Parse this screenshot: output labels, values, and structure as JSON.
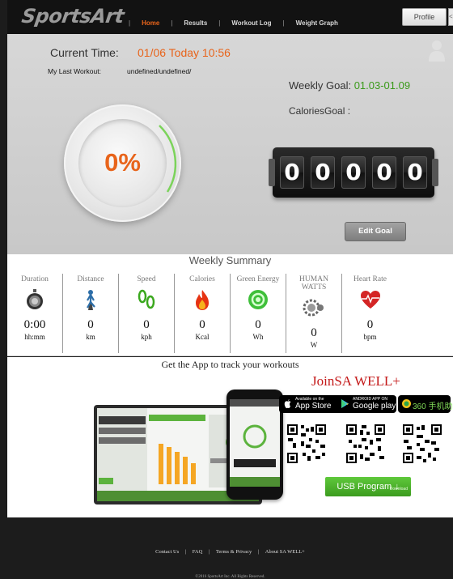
{
  "header": {
    "logo_text": "SportsArt",
    "nav": [
      {
        "label": "Home",
        "active": true
      },
      {
        "label": "Results"
      },
      {
        "label": "Workout Log"
      },
      {
        "label": "Weight Graph"
      }
    ],
    "separator": "|",
    "profile_label": "Profile",
    "profile_more": "<"
  },
  "top": {
    "current_time_label": "Current Time:",
    "current_time_value": "01/06 Today 10:56",
    "last_workout_label": "My Last Workout:",
    "last_workout_value": "undefined/undefined/",
    "weekly_goal_label": "Weekly Goal: ",
    "weekly_goal_value": "01.03-01.09",
    "calories_goal_label": "CaloriesGoal :",
    "progress_percent": "0%",
    "counter_digits": [
      "0",
      "0",
      "0",
      "0",
      "0"
    ],
    "edit_goal_label": "Edit Goal"
  },
  "summary": {
    "title": "Weekly Summary",
    "metrics": [
      {
        "label": "Duration",
        "value": "0:00",
        "unit": "hh:mm",
        "icon": "stopwatch-icon"
      },
      {
        "label": "Distance",
        "value": "0",
        "unit": "km",
        "icon": "road-icon"
      },
      {
        "label": "Speed",
        "value": "0",
        "unit": "kph",
        "icon": "footprints-icon"
      },
      {
        "label": "Calories",
        "value": "0",
        "unit": "Kcal",
        "icon": "flame-icon"
      },
      {
        "label": "Green Energy",
        "value": "0",
        "unit": "Wh",
        "icon": "green-energy-icon"
      },
      {
        "label": "HUMAN WATTS",
        "value": "0",
        "unit": "W",
        "icon": "gear-icon"
      },
      {
        "label": "Heart Rate",
        "value": "0",
        "unit": "bpm",
        "icon": "heart-icon"
      }
    ]
  },
  "app": {
    "title": "Get the App to track your workouts",
    "join_label": "Join",
    "join_brand": "SA WELL+",
    "badges": [
      {
        "small": "Available on the",
        "big": "App Store"
      },
      {
        "small": "ANDROID APP ON",
        "big": "Google play"
      },
      {
        "small": "",
        "big": "360 手机助手"
      }
    ],
    "usb_label": "USB Program",
    "usb_arrow": "↓",
    "usb_download": "Download"
  },
  "footer": {
    "links": [
      "Contact Us",
      "FAQ",
      "Terms & Privacy",
      "About SA WELL+"
    ],
    "separator": "|",
    "copyright": "©2016 SportsArt Inc. All Rights Reserved."
  },
  "colors": {
    "accent_orange": "#e8641b",
    "goal_green": "#3a9a1a",
    "join_red": "#c41a1a",
    "usb_green": "#4cb32b"
  }
}
